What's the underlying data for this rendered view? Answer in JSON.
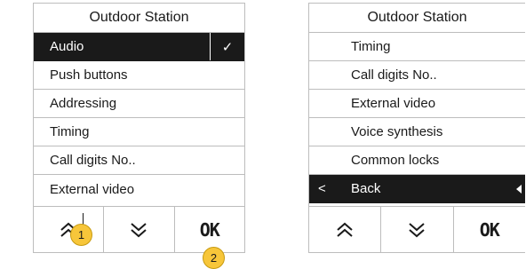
{
  "left_panel": {
    "title": "Outdoor Station",
    "items": [
      {
        "label": "Audio",
        "selected": true,
        "check": "✓"
      },
      {
        "label": "Push buttons"
      },
      {
        "label": "Addressing"
      },
      {
        "label": "Timing"
      },
      {
        "label": "Call digits No.."
      },
      {
        "label": "External video"
      }
    ],
    "buttons": {
      "up_icon": "double-chevron-up",
      "down_icon": "double-chevron-down",
      "ok_label": "OK"
    }
  },
  "right_panel": {
    "title": "Outdoor Station",
    "items": [
      {
        "label": "Timing"
      },
      {
        "label": "Call digits No.."
      },
      {
        "label": "External video"
      },
      {
        "label": "Voice synthesis"
      },
      {
        "label": "Common locks"
      }
    ],
    "back": {
      "arrow": "<",
      "label": "Back"
    },
    "buttons": {
      "up_icon": "double-chevron-up",
      "down_icon": "double-chevron-down",
      "ok_label": "OK"
    }
  },
  "markers": {
    "one": "1",
    "two": "2"
  },
  "colors": {
    "selected_bg": "#1a1a1a",
    "marker": "#f7c63a",
    "border": "#bdbdbd"
  }
}
